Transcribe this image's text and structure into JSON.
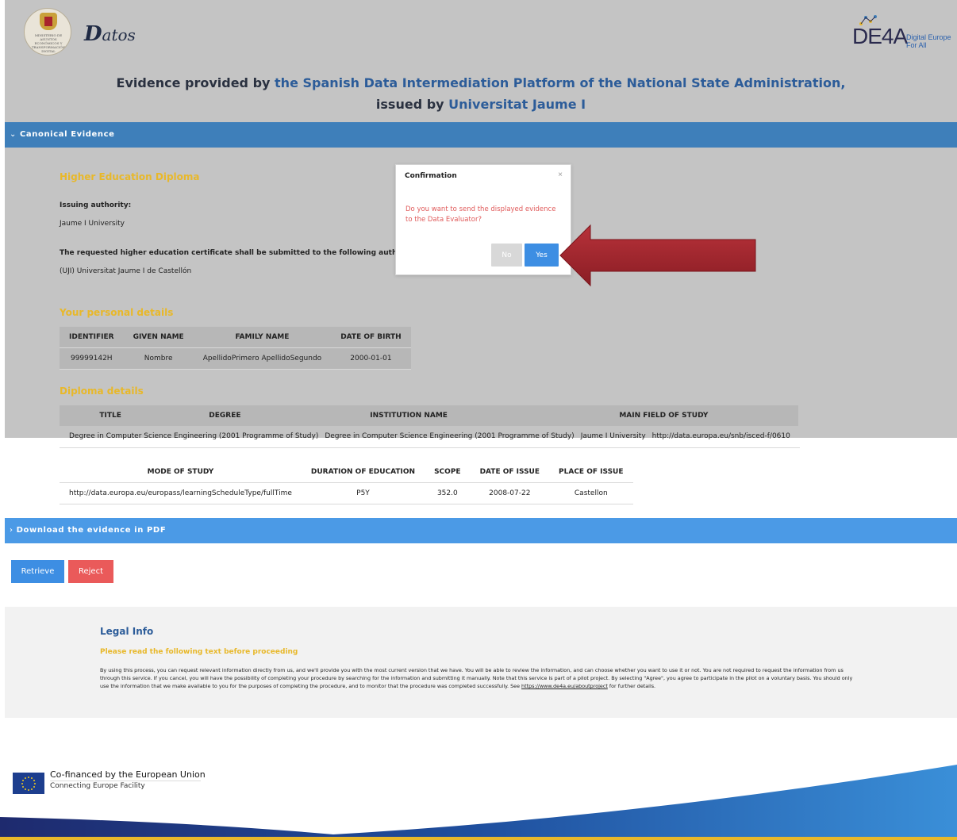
{
  "header": {
    "seal_text": "MINISTERIO DE ASUNTOS ECONÓMICOS Y TRANSFORMACIÓN DIGITAL",
    "datos_big": "D",
    "datos_rest": "atos",
    "de4a_word": "DE4A",
    "de4a_tag1": "Digital Europe",
    "de4a_tag2": "For All",
    "title_prefix": "Evidence provided by ",
    "title_platform": "the Spanish Data Intermediation Platform of the National State Administration,",
    "title_issued": "issued by ",
    "title_university": "Universitat Jaume I"
  },
  "canonical": {
    "bar_label": "Canonical Evidence",
    "diploma_title": "Higher Education Diploma",
    "issuing_label": "Issuing authority:",
    "issuing_value": "Jaume I University",
    "submit_label": "The requested higher education certificate shall be submitted to the following authority:",
    "submit_value": "(UJI) Universitat Jaume I de Castellón",
    "personal_title": "Your personal details",
    "personal_headers": [
      "IDENTIFIER",
      "GIVEN NAME",
      "FAMILY NAME",
      "DATE OF BIRTH"
    ],
    "personal_row": [
      "99999142H",
      "Nombre",
      "ApellidoPrimero ApellidoSegundo",
      "2000-01-01"
    ],
    "diploma_details_title": "Diploma details",
    "diploma_headers": [
      "TITLE",
      "DEGREE",
      "INSTITUTION NAME",
      "MAIN FIELD OF STUDY"
    ],
    "diploma_row": [
      "Degree in Computer Science Engineering (2001 Programme of Study)",
      "Degree in Computer Science Engineering (2001 Programme of Study)",
      "Jaume I University",
      "http://data.europa.eu/snb/isced-f/0610"
    ],
    "mode_headers": [
      "MODE OF STUDY",
      "DURATION OF EDUCATION",
      "SCOPE",
      "DATE OF ISSUE",
      "PLACE OF ISSUE"
    ],
    "mode_row": [
      "http://data.europa.eu/europass/learningScheduleType/fullTime",
      "P5Y",
      "352.0",
      "2008-07-22",
      "Castellon"
    ]
  },
  "modal": {
    "title": "Confirmation",
    "close": "×",
    "message": "Do you want to send the displayed evidence to the Data Evaluator?",
    "no_label": "No",
    "yes_label": "Yes"
  },
  "pdf": {
    "bar_label": "Download the evidence in PDF"
  },
  "actions": {
    "retrieve_label": "Retrieve",
    "reject_label": "Reject"
  },
  "legal": {
    "title": "Legal Info",
    "warning": "Please read the following text before proceeding",
    "body": "By using this process, you can request relevant information directly from us, and we'll provide you with the most current version that we have. You will be able to review the information, and can choose whether you want to use it or not. You are not required to request the information from us through this service. If you cancel, you will have the possibility of completing your procedure by searching for the information and submitting it manually. Note that this service is part of a pilot project. By selecting \"Agree\", you agree to participate in the pilot on a voluntary basis. You should only use the information that we make available to you for the purposes of completing the procedure, and to monitor that the procedure was completed successfully. See ",
    "link": "https://www.de4a.eu/aboutproject",
    "body_end": " for further details."
  },
  "footer": {
    "line1": "Co-financed by the European Union",
    "line2": "Connecting Europe Facility"
  },
  "colors": {
    "bar": "#3e7fba",
    "accent": "#e8b82a",
    "primary": "#3d8ee3",
    "danger": "#ea5a5a"
  }
}
